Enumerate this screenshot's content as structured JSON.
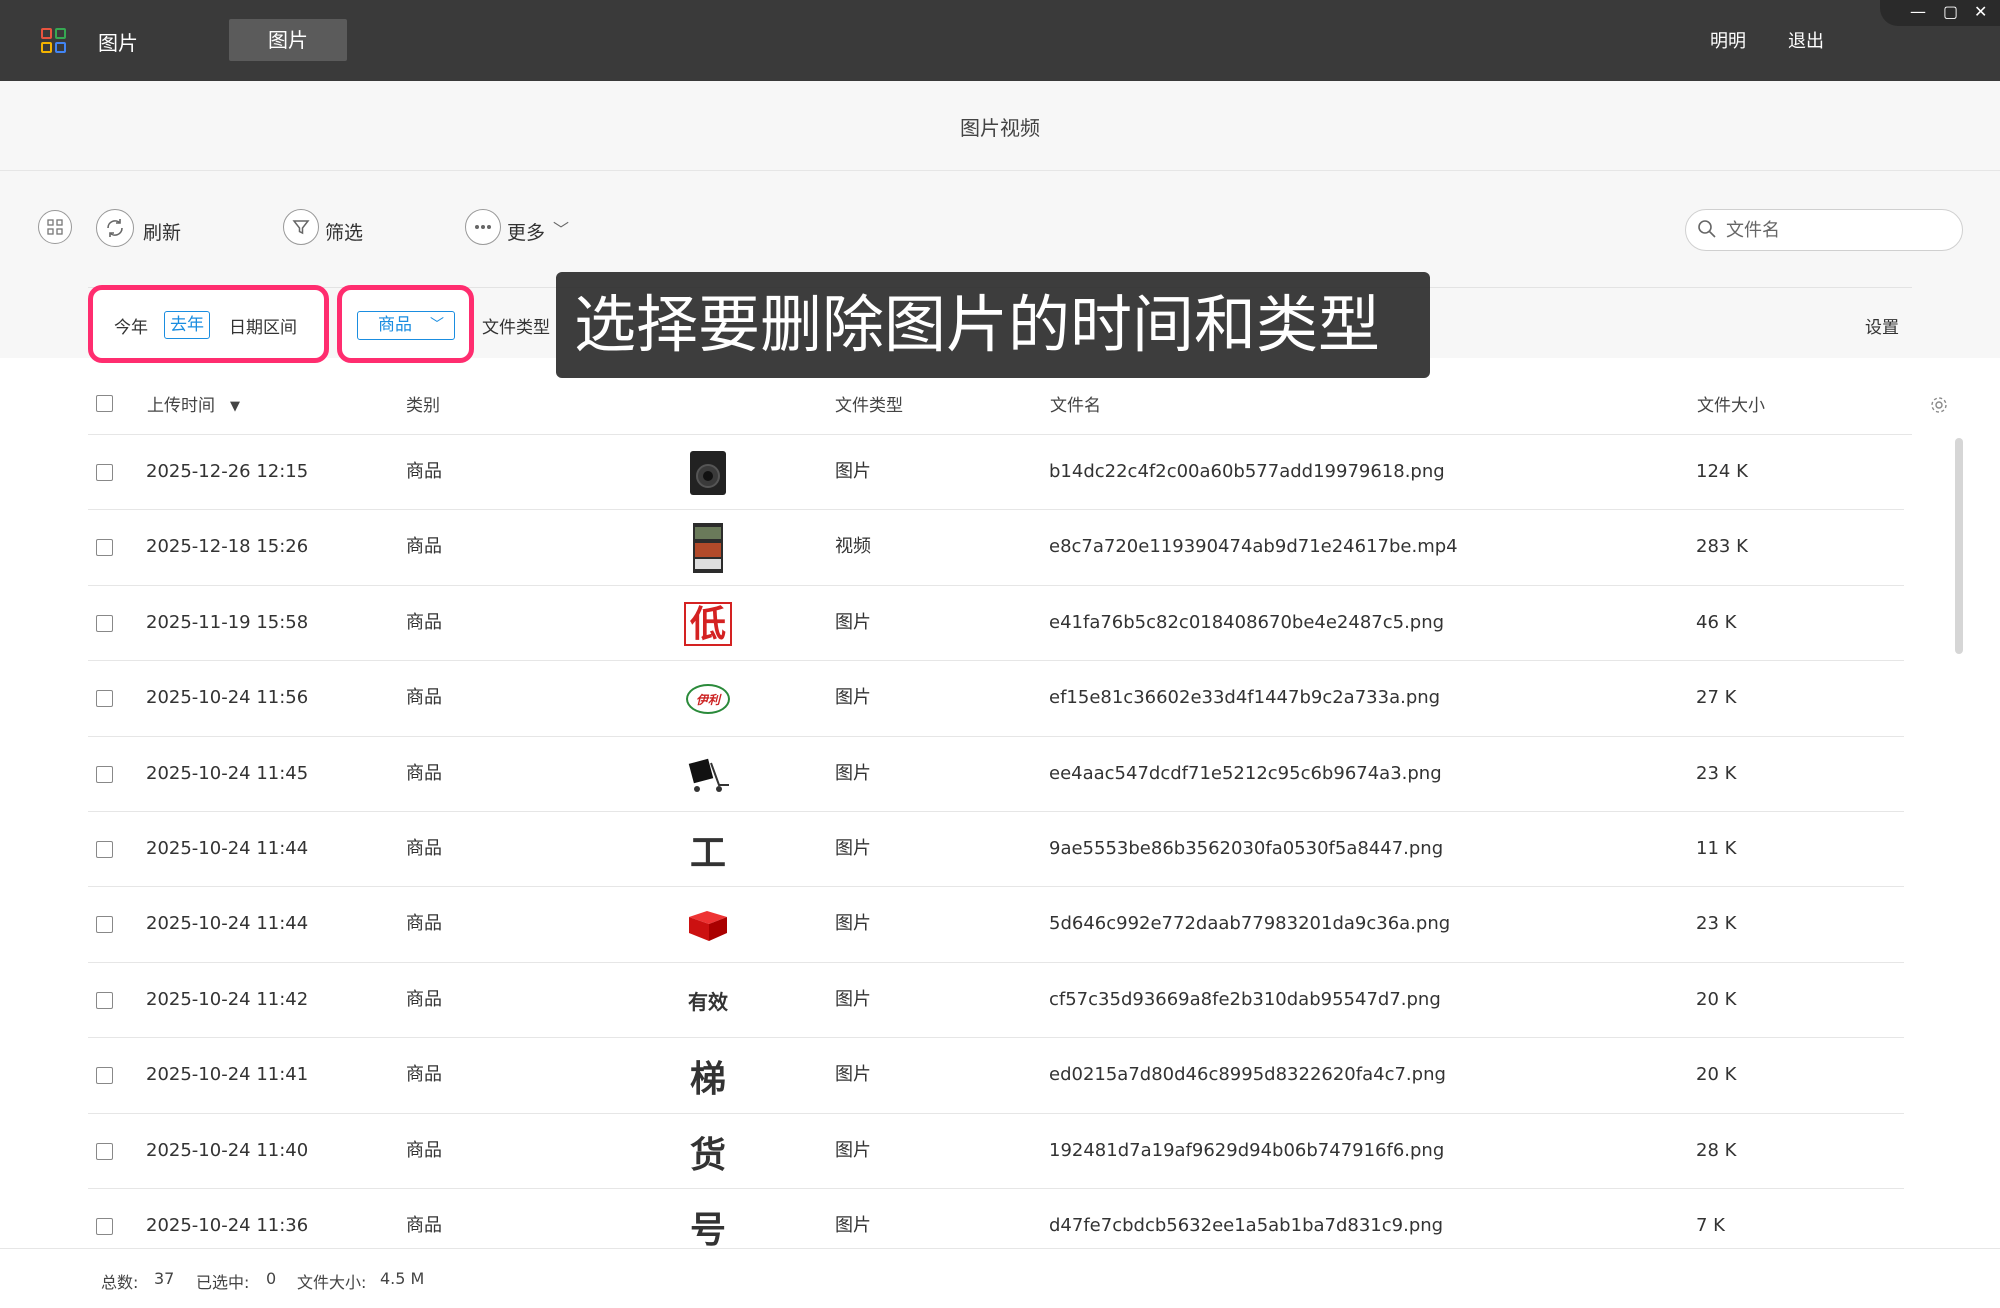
{
  "app": {
    "name": "图片",
    "active_tab": "图片",
    "user": "明明",
    "logout": "退出"
  },
  "window_controls": {
    "minimize": "—",
    "maximize": "▢",
    "close": "✕"
  },
  "page": {
    "title": "图片视频"
  },
  "toolbar": {
    "refresh": "刷新",
    "filter": "筛选",
    "more": "更多",
    "search_placeholder": "文件名"
  },
  "filters": {
    "dates": [
      "今年",
      "去年",
      "日期区间"
    ],
    "selected_date": "去年",
    "category": "商品",
    "file_type_label": "文件类型",
    "settings": "设置"
  },
  "tooltip": "选择要删除图片的时间和类型",
  "columns": {
    "upload_time": "上传时间",
    "sort_indicator": "▼",
    "category": "类别",
    "file_type": "文件类型",
    "file_name": "文件名",
    "file_size": "文件大小"
  },
  "rows": [
    {
      "time": "2025-12-26 12:15",
      "category": "商品",
      "type": "图片",
      "name": "b14dc22c4f2c00a60b577add19979618.png",
      "size": "124 K",
      "thumb": "device-icon"
    },
    {
      "time": "2025-12-18 15:26",
      "category": "商品",
      "type": "视频",
      "name": "e8c7a720e119390474ab9d71e24617be.mp4",
      "size": "283 K",
      "thumb": "video-icon"
    },
    {
      "time": "2025-11-19 15:58",
      "category": "商品",
      "type": "图片",
      "name": "e41fa76b5c82c018408670be4e2487c5.png",
      "size": "46 K",
      "thumb": "char-di-icon"
    },
    {
      "time": "2025-10-24 11:56",
      "category": "商品",
      "type": "图片",
      "name": "ef15e81c36602e33d4f1447b9c2a733a.png",
      "size": "27 K",
      "thumb": "brand-logo-icon"
    },
    {
      "time": "2025-10-24 11:45",
      "category": "商品",
      "type": "图片",
      "name": "ee4aac547dcdf71e5212c95c6b9674a3.png",
      "size": "23 K",
      "thumb": "cart-icon"
    },
    {
      "time": "2025-10-24 11:44",
      "category": "商品",
      "type": "图片",
      "name": "9ae5553be86b3562030fa0530f5a8447.png",
      "size": "11 K",
      "thumb": "char-gong-icon"
    },
    {
      "time": "2025-10-24 11:44",
      "category": "商品",
      "type": "图片",
      "name": "5d646c992e772daab77983201da9c36a.png",
      "size": "23 K",
      "thumb": "red-box-icon"
    },
    {
      "time": "2025-10-24 11:42",
      "category": "商品",
      "type": "图片",
      "name": "cf57c35d93669a8fe2b310dab95547d7.png",
      "size": "20 K",
      "thumb": "char-youxiao-icon"
    },
    {
      "time": "2025-10-24 11:41",
      "category": "商品",
      "type": "图片",
      "name": "ed0215a7d80d46c8995d8322620fa4c7.png",
      "size": "20 K",
      "thumb": "char-ti-icon"
    },
    {
      "time": "2025-10-24 11:40",
      "category": "商品",
      "type": "图片",
      "name": "192481d7a19af9629d94b06b747916f6.png",
      "size": "28 K",
      "thumb": "char-huo-icon"
    },
    {
      "time": "2025-10-24 11:36",
      "category": "商品",
      "type": "图片",
      "name": "d47fe7cbdcb5632ee1a5ab1ba7d831c9.png",
      "size": "7 K",
      "thumb": "char-hao-icon"
    }
  ],
  "thumb_chars": {
    "char-di-icon": "低",
    "brand-logo-icon": "伊利",
    "char-gong-icon": "工",
    "char-youxiao-icon": "有效",
    "char-ti-icon": "梯",
    "char-huo-icon": "货",
    "char-hao-icon": "号"
  },
  "footer": {
    "total_label": "总数:",
    "total": "37",
    "selected_label": "已选中:",
    "selected": "0",
    "size_label": "文件大小:",
    "size": "4.5 M"
  },
  "colors": {
    "accent": "#1a8de0",
    "highlight": "#ff2d6f",
    "titlebar": "#3a3a3a"
  }
}
